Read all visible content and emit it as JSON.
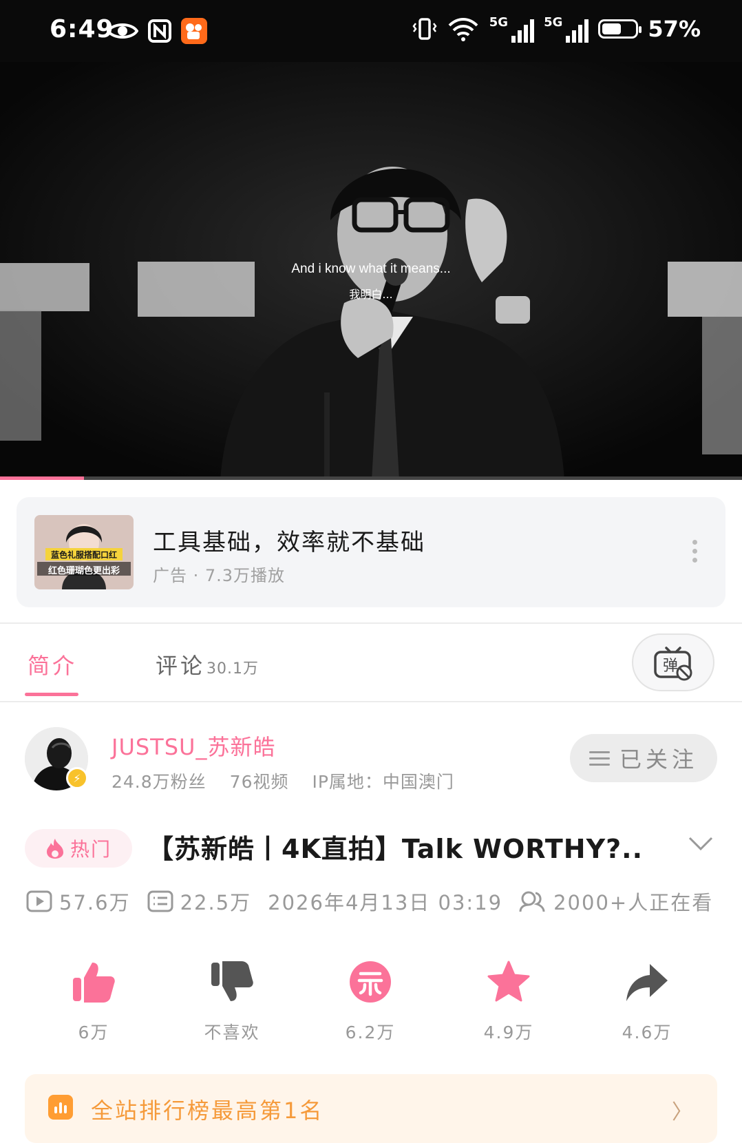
{
  "status_bar": {
    "time": "6:49",
    "left_icons": [
      "eye-icon",
      "nfc-icon",
      "kuaishou-app-icon"
    ],
    "network_1": "5G",
    "network_2": "5G",
    "wifi_label": "6",
    "battery_percent": 57,
    "battery_text": "57%"
  },
  "video": {
    "subtitle_en": "And i know what it means...",
    "subtitle_cn": "我明白...",
    "progress": 0.113,
    "progress_color": "#fb7299"
  },
  "ad": {
    "thumb_caption_top": "蓝色礼服搭配口红",
    "thumb_caption_bottom": "红色珊瑚色更出彩",
    "title": "工具基础，效率就不基础",
    "meta": "广告 · 7.3万播放"
  },
  "tabs": {
    "intro": "简介",
    "comments": "评论",
    "comments_count": "30.1万",
    "danmu_icon": "danmu-off-icon"
  },
  "uploader": {
    "name": "JUSTSU_苏新皓",
    "fans": "24.8万粉丝",
    "videos": "76视频",
    "ip": "IP属地：中国澳门",
    "follow_label": "已关注"
  },
  "video_info": {
    "hot_tag": "热门",
    "title": "【苏新皓丨4K直拍】Talk WORTHY?...",
    "plays": "57.6万",
    "danmaku": "22.5万",
    "datetime": "2026年4月13日 03:19",
    "watching": "2000+人正在看"
  },
  "actions": {
    "like": "6万",
    "dislike": "不喜欢",
    "coin": "6.2万",
    "favorite": "4.9万",
    "share": "4.6万"
  },
  "rank_banner": {
    "text": "全站排行榜最高第1名"
  },
  "colors": {
    "accent": "#fb7299",
    "rank_orange": "#f59a3a"
  }
}
